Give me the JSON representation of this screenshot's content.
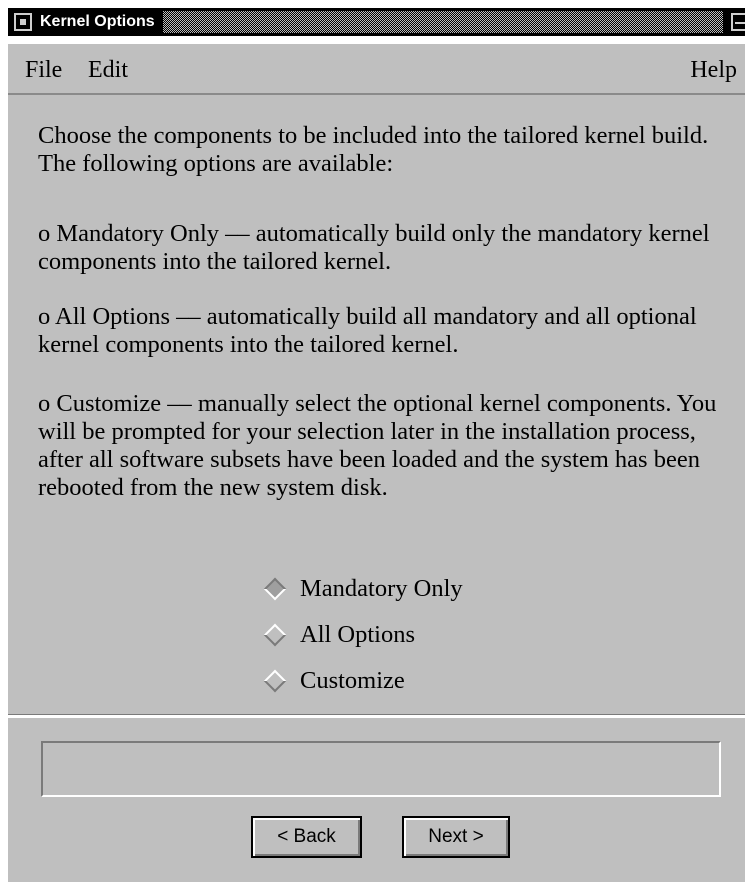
{
  "window": {
    "title": "Kernel Options"
  },
  "menubar": {
    "file": "File",
    "edit": "Edit",
    "help": "Help"
  },
  "description": [
    "Choose the components to be included into the tailored kernel build.  The following options are available:",
    "o  Mandatory Only –– automatically build only the mandatory kernel components into the tailored kernel.",
    "o  All Options –– automatically build all mandatory and all optional kernel components into the tailored kernel.",
    "o  Customize –– manually select the optional kernel components. You will be prompted for your selection later in the installation process, after all software subsets have been loaded and the system has been rebooted from the new system disk."
  ],
  "options": [
    {
      "label": "Mandatory Only",
      "selected": true
    },
    {
      "label": "All Options",
      "selected": false
    },
    {
      "label": "Customize",
      "selected": false
    }
  ],
  "message_area": {
    "text": ""
  },
  "buttons": {
    "back": "< Back",
    "next": "Next >"
  },
  "colors": {
    "background": "#bfbfbf",
    "titlebar": "#000000",
    "shadow": "#7a7a7a",
    "highlight": "#ffffff"
  }
}
